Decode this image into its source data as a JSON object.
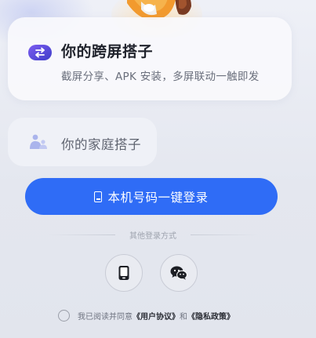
{
  "cards": {
    "primary": {
      "title": "你的跨屏搭子",
      "subtitle": "截屏分享、APK 安装，多屏联动一触即发",
      "icon": "swap-arrows-icon",
      "accent": "#5a4bd6"
    },
    "family": {
      "title": "你的家庭搭子",
      "icon": "family-icon",
      "accent": "#a9b3ec"
    }
  },
  "login": {
    "primary_button": "本机号码一键登录",
    "primary_icon": "phone-icon",
    "primary_color": "#2f6cf6",
    "other_methods_label": "其他登录方式",
    "other_methods": [
      {
        "name": "phone-login",
        "icon": "mobile-phone-icon"
      },
      {
        "name": "wechat-login",
        "icon": "wechat-icon"
      }
    ]
  },
  "agreement": {
    "prefix": "我已阅读并同意",
    "user_agreement": "《用户协议》",
    "and": "和",
    "privacy_policy": "《隐私政策》"
  }
}
